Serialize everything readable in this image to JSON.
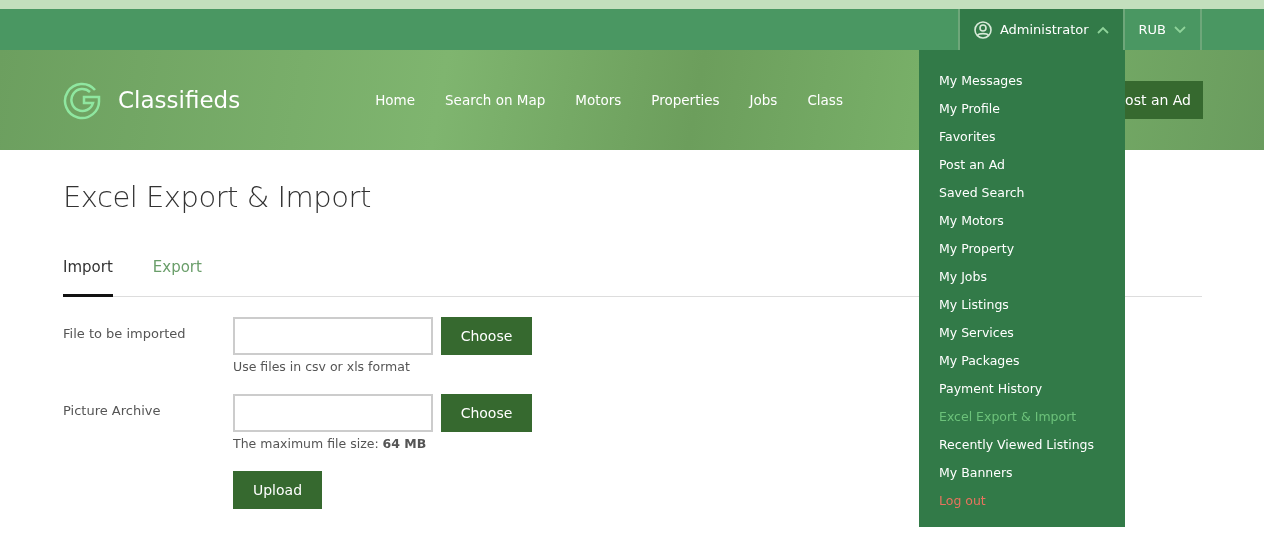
{
  "topbar": {
    "user": {
      "label": "Administrator",
      "expanded": true
    },
    "currency": {
      "label": "RUB",
      "expanded": false
    }
  },
  "header": {
    "logo": "Classifieds",
    "nav": [
      "Home",
      "Search on Map",
      "Motors",
      "Properties",
      "Jobs",
      "Class"
    ],
    "post_button": "ost an Ad"
  },
  "user_menu": [
    {
      "label": "My Messages",
      "kind": "link",
      "selected": false
    },
    {
      "label": "My Profile",
      "kind": "link",
      "selected": false
    },
    {
      "label": "Favorites",
      "kind": "link",
      "selected": false
    },
    {
      "label": "Post an Ad",
      "kind": "link",
      "selected": false
    },
    {
      "label": "Saved Search",
      "kind": "link",
      "selected": false
    },
    {
      "label": "My Motors",
      "kind": "link",
      "selected": false
    },
    {
      "label": "My Property",
      "kind": "link",
      "selected": false
    },
    {
      "label": "My Jobs",
      "kind": "link",
      "selected": false
    },
    {
      "label": "My Listings",
      "kind": "link",
      "selected": false
    },
    {
      "label": "My Services",
      "kind": "link",
      "selected": false
    },
    {
      "label": "My Packages",
      "kind": "link",
      "selected": false
    },
    {
      "label": "Payment History",
      "kind": "link",
      "selected": false
    },
    {
      "label": "Excel Export & Import",
      "kind": "link",
      "selected": true
    },
    {
      "label": "Recently Viewed Listings",
      "kind": "link",
      "selected": false
    },
    {
      "label": "My Banners",
      "kind": "link",
      "selected": false
    },
    {
      "label": "Log out",
      "kind": "logout",
      "selected": false
    }
  ],
  "page": {
    "title": "Excel Export & Import",
    "tabs": [
      {
        "label": "Import",
        "selected": true
      },
      {
        "label": "Export",
        "selected": false
      }
    ],
    "fields": [
      {
        "label": "File to be imported",
        "button": "Choose",
        "hint": "Use files in csv or xls format"
      },
      {
        "label": "Picture Archive",
        "button": "Choose",
        "hint": "The maximum file size: **64 MB**"
      }
    ],
    "submit": "Upload"
  }
}
